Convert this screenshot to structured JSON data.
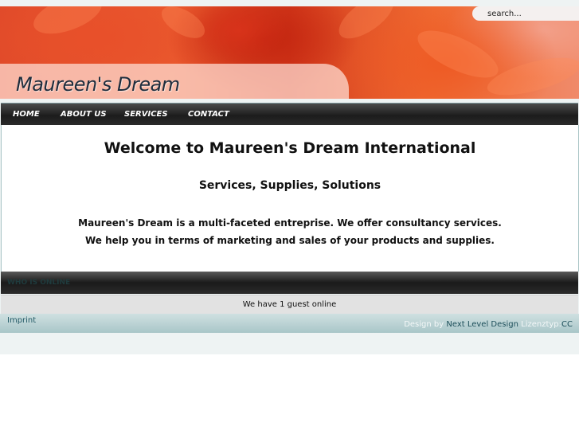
{
  "header": {
    "site_title": "Maureen's Dream",
    "search_placeholder": "search..."
  },
  "nav": {
    "items": [
      {
        "label": "HOME"
      },
      {
        "label": "ABOUT US"
      },
      {
        "label": "SERVICES"
      },
      {
        "label": "CONTACT"
      }
    ]
  },
  "main": {
    "heading": "Welcome to Maureen's Dream International",
    "subheading": "Services, Supplies, Solutions",
    "paragraphs": [
      "Maureen's Dream is a multi-faceted entreprise. We offer consultancy services.",
      "We help you in terms of marketing and sales of your products and supplies."
    ]
  },
  "whos_online": {
    "title": "WHO IS ONLINE",
    "status": "We have 1 guest online"
  },
  "footer": {
    "imprint_label": "Imprint",
    "design_by_label": "Design by",
    "designer_link": "Next Level Design",
    "license_label": "Lizenztyp:",
    "license_link": "CC"
  },
  "colors": {
    "banner_accent": "#e04a2a",
    "nav_background": "#1c1c1c",
    "footer_background": "#a9c6c8"
  }
}
